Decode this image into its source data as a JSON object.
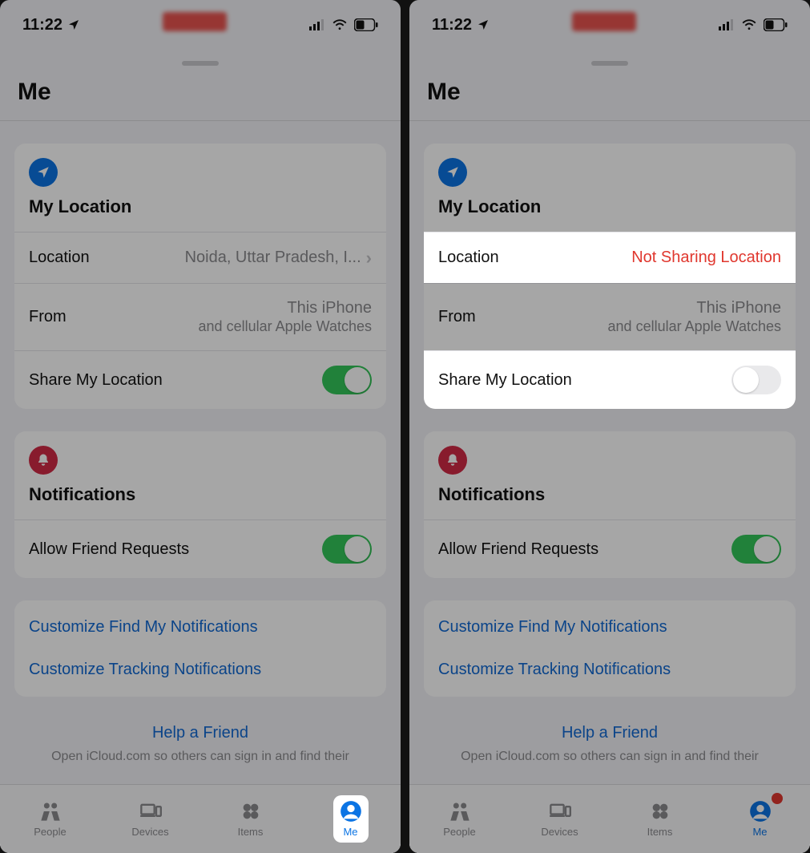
{
  "status": {
    "time": "11:22"
  },
  "title": "Me",
  "section_location": {
    "title": "My Location"
  },
  "row_location": {
    "label": "Location",
    "value_left": "Noida, Uttar Pradesh, I...",
    "value_right": "Not Sharing Location"
  },
  "row_from": {
    "label": "From",
    "value": "This iPhone",
    "sub": "and cellular Apple Watches"
  },
  "row_share": {
    "label": "Share My Location"
  },
  "section_notifications": {
    "title": "Notifications"
  },
  "row_allow": {
    "label": "Allow Friend Requests"
  },
  "links": {
    "findmy": "Customize Find My Notifications",
    "tracking": "Customize Tracking Notifications"
  },
  "help": {
    "cta": "Help a Friend",
    "desc": "Open iCloud.com so others can sign in and find their"
  },
  "tabs": {
    "people": "People",
    "devices": "Devices",
    "items": "Items",
    "me": "Me"
  }
}
